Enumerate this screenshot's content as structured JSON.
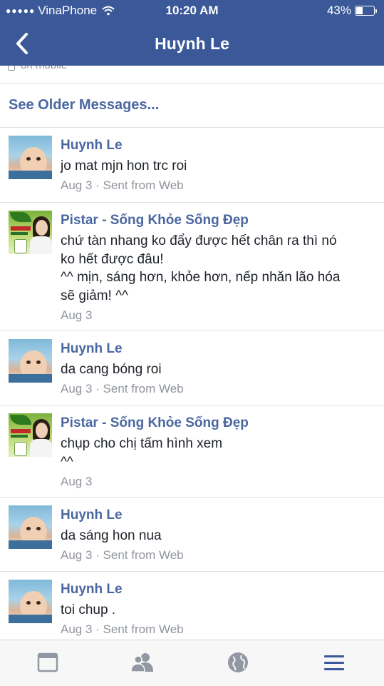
{
  "status_bar": {
    "carrier": "VinaPhone",
    "time": "10:20 AM",
    "battery_percent_text": "43%",
    "battery_level": 0.43
  },
  "nav": {
    "title": "Huynh Le",
    "back_icon": "chevron-left-icon"
  },
  "partial_row": {
    "text": "on mobile",
    "icon": "phone-icon"
  },
  "older_messages": {
    "label": "See Older Messages..."
  },
  "messages": [
    {
      "sender": "Huynh Le",
      "lines": [
        "jo mat mjn hon trc roi"
      ],
      "meta": "Aug 3 · Sent from Web"
    },
    {
      "sender": "Pistar - Sống Khỏe Sống Đẹp",
      "lines": [
        "chứ tàn nhang ko đẩy được hết chân ra thì nó",
        "ko hết được đâu!",
        "^^ mịn, sáng hơn, khỏe hơn, nếp nhăn lão hóa",
        "sẽ giảm! ^^"
      ],
      "meta": "Aug 3"
    },
    {
      "sender": "Huynh Le",
      "lines": [
        "da cang bóng roi"
      ],
      "meta": "Aug 3 · Sent from Web"
    },
    {
      "sender": "Pistar - Sống Khỏe Sống Đẹp",
      "lines": [
        "chụp cho chị tấm hình xem",
        "^^"
      ],
      "meta": "Aug 3"
    },
    {
      "sender": "Huynh Le",
      "lines": [
        "da sáng hon nua"
      ],
      "meta": "Aug 3 · Sent from Web"
    },
    {
      "sender": "Huynh Le",
      "lines": [
        "toi chup ."
      ],
      "meta": "Aug 3 · Sent from Web"
    }
  ],
  "tab_bar": {
    "tabs": [
      {
        "icon": "news-feed-icon"
      },
      {
        "icon": "friends-icon"
      },
      {
        "icon": "globe-icon"
      },
      {
        "icon": "menu-icon"
      }
    ]
  },
  "colors": {
    "header_bg": "#3b5998",
    "name_blue": "#4b67a1",
    "meta_gray": "#90949c",
    "divider": "#e1e2e5",
    "tab_icon_gray": "#9197a3",
    "tab_icon_active": "#3b5998"
  }
}
